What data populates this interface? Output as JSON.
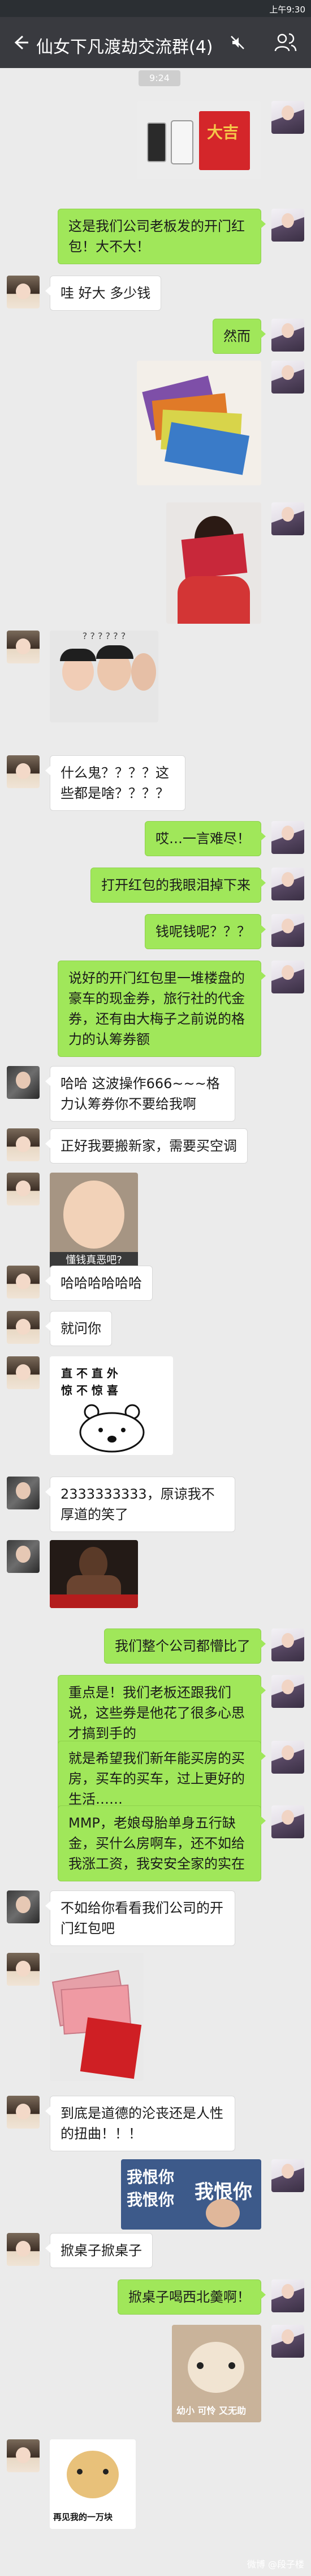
{
  "status_bar": {
    "left": "",
    "right": "上午9:30"
  },
  "header": {
    "title": "仙女下凡渡劫交流群(4)"
  },
  "timestamp": "9:24",
  "messages": {
    "m1": "这是我们公司老板发的开门红包！大不大！",
    "m2": "哇 好大 多少钱",
    "m3": "然而",
    "m4": "什么鬼？？？？这些都是啥？？？？",
    "m5": "哎…一言难尽！",
    "m6": "打开红包的我眼泪掉下来",
    "m7": "钱呢钱呢？？？",
    "m8": "说好的开门红包里一堆楼盘的豪车的现金券，旅行社的代金券，还有由大梅子之前说的格力的认筹券额",
    "m9": "哈哈 这波操作666~~~格力认筹券你不要给我啊",
    "m10": "正好我要搬新家，需要买空调",
    "m11": "哈哈哈哈哈哈",
    "m12": "就问你",
    "m13": "2333333333，原谅我不厚道的笑了",
    "m14": "我们整个公司都懵比了",
    "m15": "重点是！我们老板还跟我们说，这些券是他花了很多心思才搞到手的",
    "m16": "就是希望我们新年能买房的买房，买车的买车，过上更好的生活……",
    "m17": "MMP，老娘母胎单身五行缺金，买什么房啊车，还不如给我涨工资，我安安全家的实在",
    "m18": "不如给你看看我们公司的开门红包吧",
    "m19": "到底是道德的沦丧还是人性的扭曲！！！",
    "m20": "掀桌子掀桌子",
    "m21": "掀桌子喝西北羹啊！"
  },
  "stickers": {
    "s1": "懂钱真恶吧?",
    "s2_top": "直 不 直 外",
    "s2_bottom": "惊 不 惊 喜",
    "s3": "我恨你",
    "s4": "幼小 可怜 又无助",
    "s5": "再见我的一万块"
  },
  "watermark": "微博 @段子楼"
}
